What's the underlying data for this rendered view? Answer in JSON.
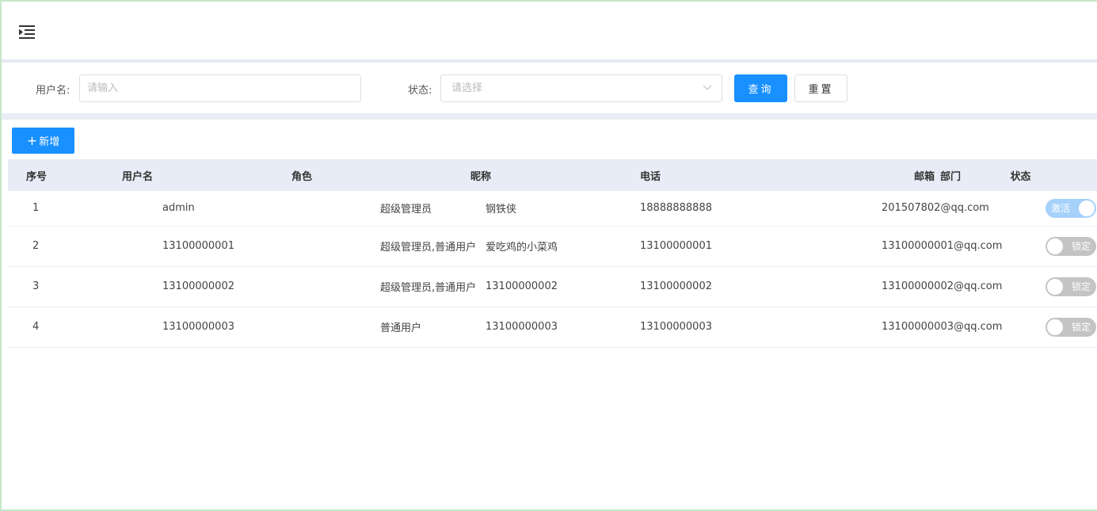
{
  "icons": {
    "menu": "indent-menu-icon",
    "select": "chevron-down-icon",
    "add": "plus-icon"
  },
  "colors": {
    "primary": "#1890ff",
    "switch_on": "#a6d1fb",
    "switch_off": "#c4c4c4",
    "header_bg": "#e8ecf6"
  },
  "search": {
    "username_label": "用户名:",
    "username_placeholder": "请输入",
    "status_label": "状态:",
    "status_placeholder": "请选择",
    "query_button": "查询",
    "reset_button": "重置"
  },
  "toolbar": {
    "add_button": "新增"
  },
  "table": {
    "headers": [
      "序号",
      "用户名",
      "角色",
      "昵称",
      "电话",
      "邮箱",
      "部门",
      "状态"
    ],
    "rows": [
      {
        "index": "1",
        "username": "admin",
        "role": "超级管理员",
        "nickname": "钢铁侠",
        "phone": "18888888888",
        "email": "201507802@qq.com",
        "dept": "",
        "status": "激活",
        "enabled": true
      },
      {
        "index": "2",
        "username": "13100000001",
        "role": "超级管理员,普通用户",
        "nickname": "爱吃鸡的小菜鸡",
        "phone": "13100000001",
        "email": "13100000001@qq.com",
        "dept": "",
        "status": "锁定",
        "enabled": false
      },
      {
        "index": "3",
        "username": "13100000002",
        "role": "超级管理员,普通用户",
        "nickname": "13100000002",
        "phone": "13100000002",
        "email": "13100000002@qq.com",
        "dept": "",
        "status": "锁定",
        "enabled": false
      },
      {
        "index": "4",
        "username": "13100000003",
        "role": "普通用户",
        "nickname": "13100000003",
        "phone": "13100000003",
        "email": "13100000003@qq.com",
        "dept": "",
        "status": "锁定",
        "enabled": false
      }
    ]
  }
}
